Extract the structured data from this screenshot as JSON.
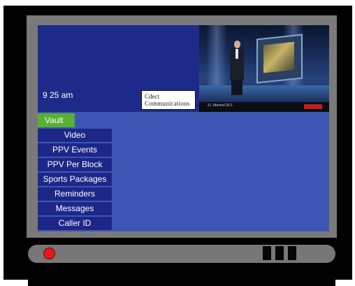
{
  "header": {
    "time": "9 25 am",
    "provider_logo": {
      "line1": "Cdect",
      "line2": "Communications"
    }
  },
  "video": {
    "ticker_text": "3 L Marinol 03-1"
  },
  "vault_tab": {
    "label": "Vault"
  },
  "menu": {
    "items": [
      {
        "label": "Video"
      },
      {
        "label": "PPV Events"
      },
      {
        "label": "PPV Per Block"
      },
      {
        "label": "Sports Packages"
      },
      {
        "label": "Reminders"
      },
      {
        "label": "Messages"
      },
      {
        "label": "Caller ID"
      }
    ]
  },
  "colors": {
    "screen_background": "#3d56b4",
    "menu_item": "#1c2788",
    "vault_tab": "#58b030",
    "power_button": "#e01a1a"
  },
  "icons": {
    "power": "power-button-icon",
    "control_buttons": "control-buttons"
  }
}
